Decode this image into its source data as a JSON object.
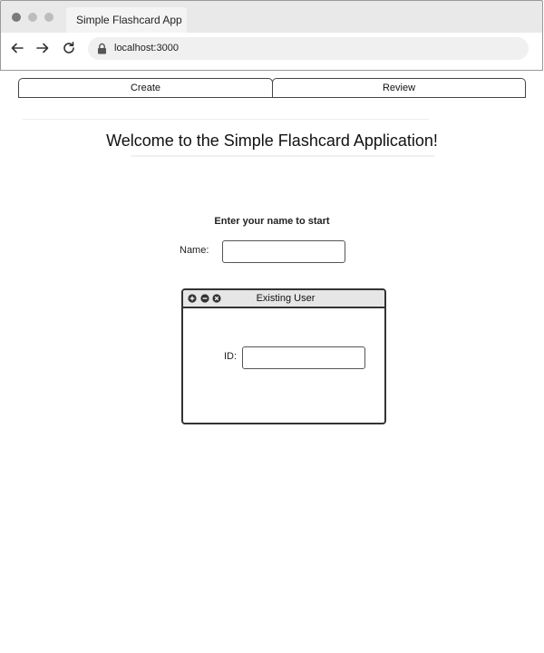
{
  "browser": {
    "tab_title": "Simple Flashcard App",
    "url": "localhost:3000",
    "icons": {
      "back": "arrow-left-icon",
      "forward": "arrow-right-icon",
      "reload": "reload-icon",
      "lock": "lock-icon"
    }
  },
  "tabs": [
    {
      "label": "Create"
    },
    {
      "label": "Review"
    }
  ],
  "main": {
    "welcome": "Welcome to the Simple Flashcard Application!",
    "prompt": "Enter your name to start",
    "name_label": "Name:",
    "name_value": ""
  },
  "existing_user": {
    "title": "Existing User",
    "id_label": "ID:",
    "id_value": ""
  },
  "colors": {
    "chrome_bg": "#e9e9e9",
    "border": "#333333",
    "title_bar": "#e6e6e6"
  }
}
